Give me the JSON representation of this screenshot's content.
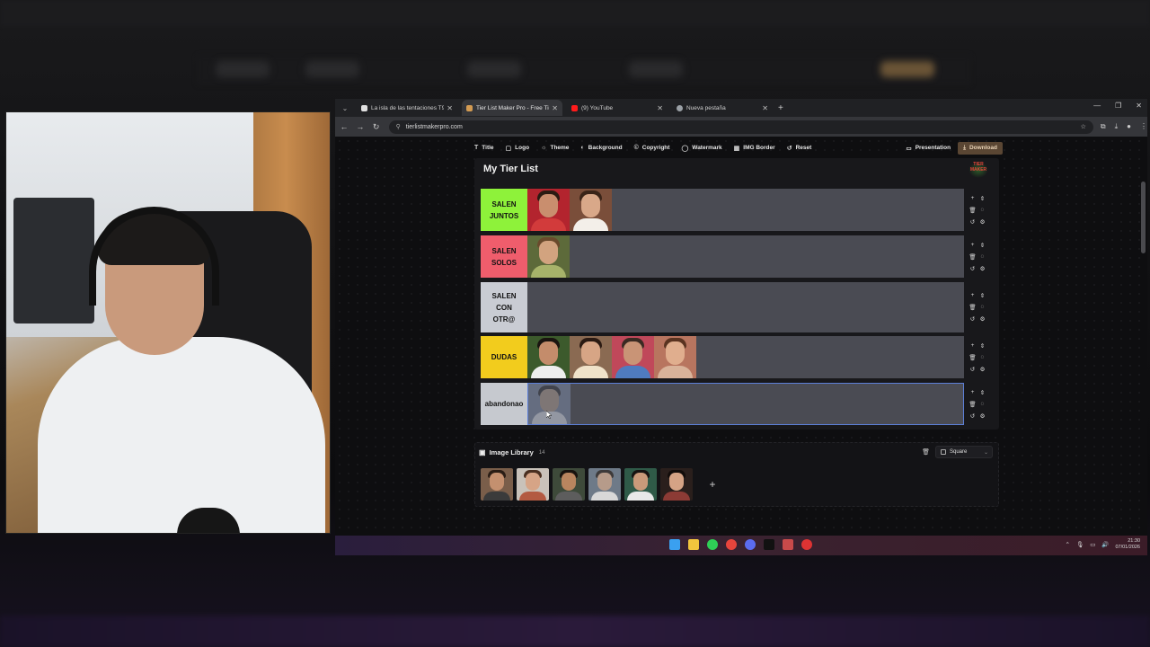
{
  "browser": {
    "tabs": [
      {
        "label": "La isla de las tentaciones T9 | M",
        "favicon_color": "#e0e0e0",
        "active": false
      },
      {
        "label": "Tier List Maker Pro - Free Tier L",
        "favicon_color": "#d39b52",
        "active": true
      },
      {
        "label": "(9) YouTube",
        "favicon_color": "#ff1b1b",
        "active": false
      },
      {
        "label": "Nueva pestaña",
        "favicon_color": "#9aa0a6",
        "active": false
      }
    ],
    "url": "tierlistmakerpro.com"
  },
  "toolbar": {
    "items": [
      {
        "label": "Title",
        "icon": "title-icon",
        "glyph": "T"
      },
      {
        "label": "Logo",
        "icon": "image-icon",
        "glyph": "▢"
      },
      {
        "label": "Theme",
        "icon": "sun-icon",
        "glyph": "☼"
      },
      {
        "label": "Background",
        "icon": "palette-icon",
        "glyph": "◐"
      },
      {
        "label": "Copyright",
        "icon": "copyright-icon",
        "glyph": "©"
      },
      {
        "label": "Watermark",
        "icon": "drop-icon",
        "glyph": "◯"
      },
      {
        "label": "IMG Border",
        "icon": "border-icon",
        "glyph": "▦"
      },
      {
        "label": "Reset",
        "icon": "reset-icon",
        "glyph": "↺"
      }
    ],
    "presentation": "Presentation",
    "download": "Download"
  },
  "tier_list": {
    "title": "My Tier List",
    "logo_text": "TIER MAKER",
    "rows": [
      {
        "label": "SALEN JUNTOS",
        "color": "#8ef23a",
        "images": 2
      },
      {
        "label": "SALEN SOLOS",
        "color": "#ef5d6c",
        "images": 1
      },
      {
        "label": "SALEN CON OTR@",
        "color": "#c9ccd3",
        "images": 0
      },
      {
        "label": "DUDAS",
        "color": "#f2cc1d",
        "images": 4
      },
      {
        "label": "abandonao",
        "color": "#c6c9cf",
        "images": 1
      }
    ]
  },
  "library": {
    "title": "Image Library",
    "count": "14",
    "shape": "Square",
    "images": 6
  },
  "taskbar": {
    "time": "21:30",
    "date": "07/01/2026"
  }
}
